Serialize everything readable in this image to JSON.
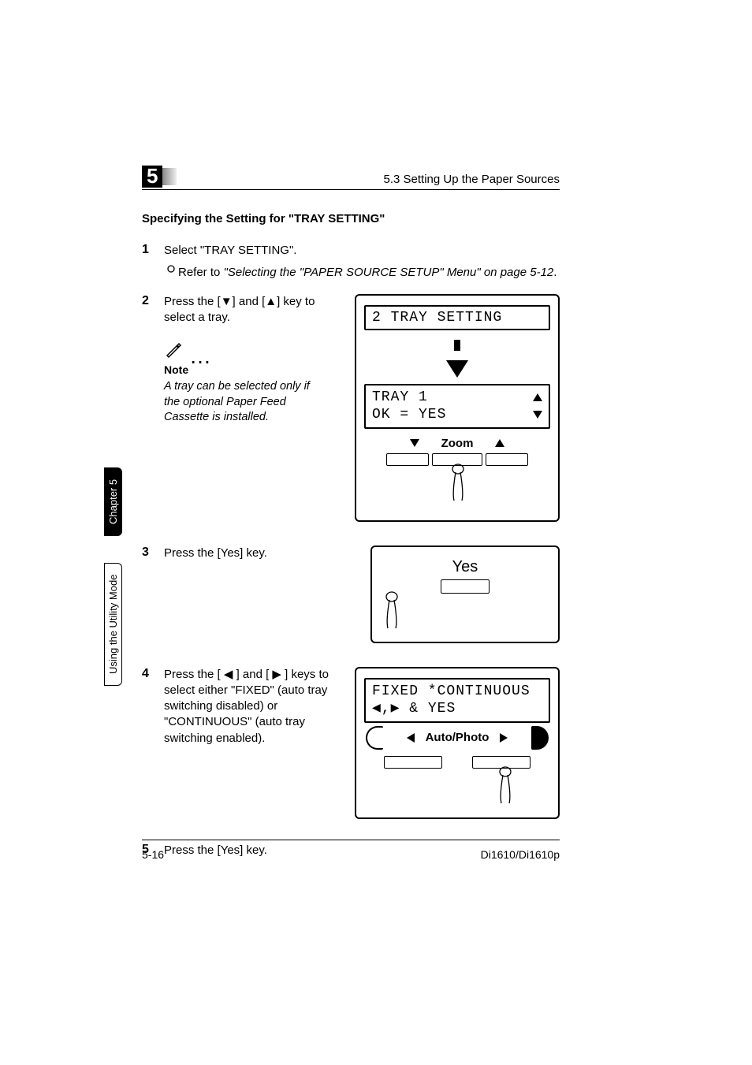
{
  "header": {
    "chapter_number": "5",
    "section_ref": "5.3 Setting Up the Paper Sources"
  },
  "sidebar": {
    "tab_chapter": "Chapter 5",
    "tab_mode": "Using the Utility Mode"
  },
  "title": "Specifying the Setting for \"TRAY SETTING\"",
  "steps": {
    "s1": {
      "num": "1",
      "text": "Select \"TRAY SETTING\".",
      "sub": "Refer to ",
      "sub_ref": "\"Selecting the \"PAPER SOURCE SETUP\" Menu\" on page 5-12",
      "sub_end": "."
    },
    "s2": {
      "num": "2",
      "text": "Press the [▼] and [▲] key to select a tray.",
      "note_label": "Note",
      "note_body": "A tray can be selected only if the optional Paper Feed Cassette is installed.",
      "lcd1": "2 TRAY SETTING",
      "lcd2_line1": "TRAY 1",
      "lcd2_line2": "OK = YES",
      "zoom_label": "Zoom"
    },
    "s3": {
      "num": "3",
      "text": "Press the [Yes] key.",
      "yes_label": "Yes"
    },
    "s4": {
      "num": "4",
      "text": "Press the [ ◀ ] and [ ▶ ] keys to select either \"FIXED\" (auto tray switching disabled) or \"CONTINUOUS\" (auto tray switching enabled).",
      "lcd_line1": "FIXED  *CONTINUOUS",
      "lcd_line2_keys": "◀,▶ & YES",
      "ap_label": "Auto/Photo"
    },
    "s5": {
      "num": "5",
      "text": "Press the [Yes] key."
    }
  },
  "footer": {
    "page": "5-16",
    "model": "Di1610/Di1610p"
  }
}
